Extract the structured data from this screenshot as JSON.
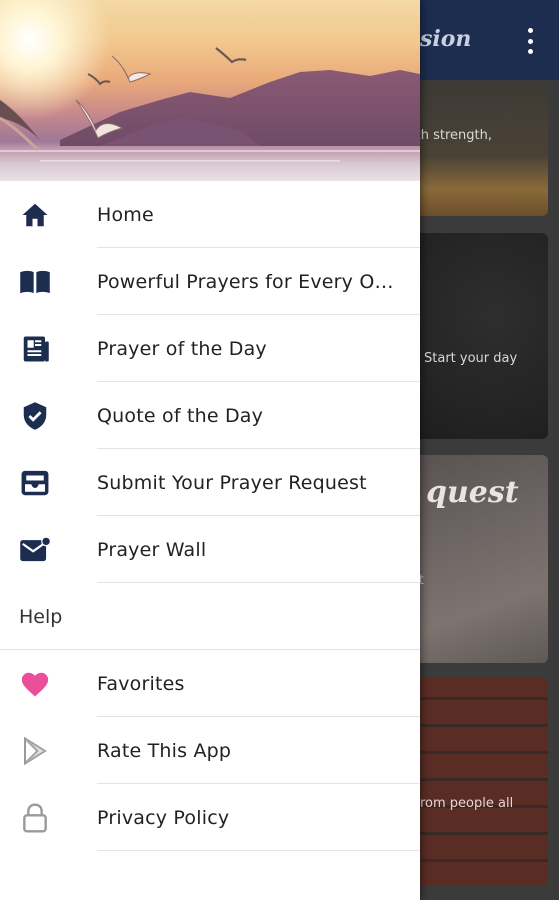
{
  "app": {
    "title_fragment": "sion",
    "colors": {
      "app_bar": "#1d2d50",
      "icon_navy": "#1d2d50",
      "heart_pink": "#ec4f9a",
      "icon_gray": "#9a9a9a"
    }
  },
  "cards": [
    {
      "text": "ith strength,"
    },
    {
      "text": "Start your day"
    },
    {
      "big_text": "quest",
      "text": "st"
    },
    {
      "text": "rom people all"
    }
  ],
  "drawer": {
    "header_image": "sunset-sea-birds",
    "menu": [
      {
        "label": "Home",
        "icon": "home-icon"
      },
      {
        "label": "Powerful Prayers for Every Oc...",
        "icon": "book-icon"
      },
      {
        "label": "Prayer of the Day",
        "icon": "newspaper-icon"
      },
      {
        "label": "Quote of the Day",
        "icon": "shield-check-icon"
      },
      {
        "label": "Submit Your Prayer Request",
        "icon": "inbox-icon"
      },
      {
        "label": "Prayer Wall",
        "icon": "mail-notification-icon"
      }
    ],
    "section_header": "Help",
    "help_menu": [
      {
        "label": "Favorites",
        "icon": "heart-icon"
      },
      {
        "label": "Rate This App",
        "icon": "play-store-icon"
      },
      {
        "label": "Privacy Policy",
        "icon": "lock-icon"
      }
    ]
  }
}
